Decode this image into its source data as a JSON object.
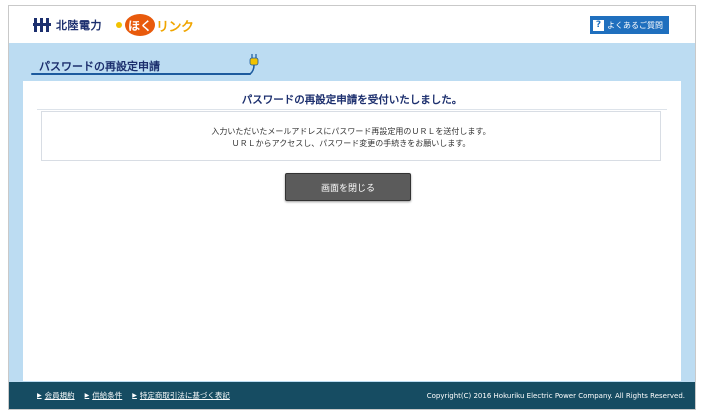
{
  "header": {
    "company_name": "北陸電力",
    "service_logo_circle": "ほく",
    "service_logo_rest": "リンク",
    "faq_icon_text": "?",
    "faq_label": "よくあるご質問"
  },
  "page": {
    "title": "パスワードの再設定申請",
    "heading": "パスワードの再設定申請を受付いたしました。",
    "message_line1": "入力いただいたメールアドレスにパスワード再設定用のＵＲＬを送付します。",
    "message_line2": "ＵＲＬからアクセスし、パスワード変更の手続きをお願いします。",
    "close_button": "画面を閉じる"
  },
  "footer": {
    "links": [
      {
        "label": "会員規約"
      },
      {
        "label": "供給条件"
      },
      {
        "label": "特定商取引法に基づく表記"
      }
    ],
    "copyright": "Copyright(C) 2016 Hokuriku Electric Power Company. All Rights Reserved."
  },
  "colors": {
    "band": "#bcdcf2",
    "navy": "#1c2f6e",
    "footer": "#164c62",
    "faq": "#1f6fbe",
    "logo_orange": "#e85a0c",
    "logo_yellow": "#f0a500"
  }
}
